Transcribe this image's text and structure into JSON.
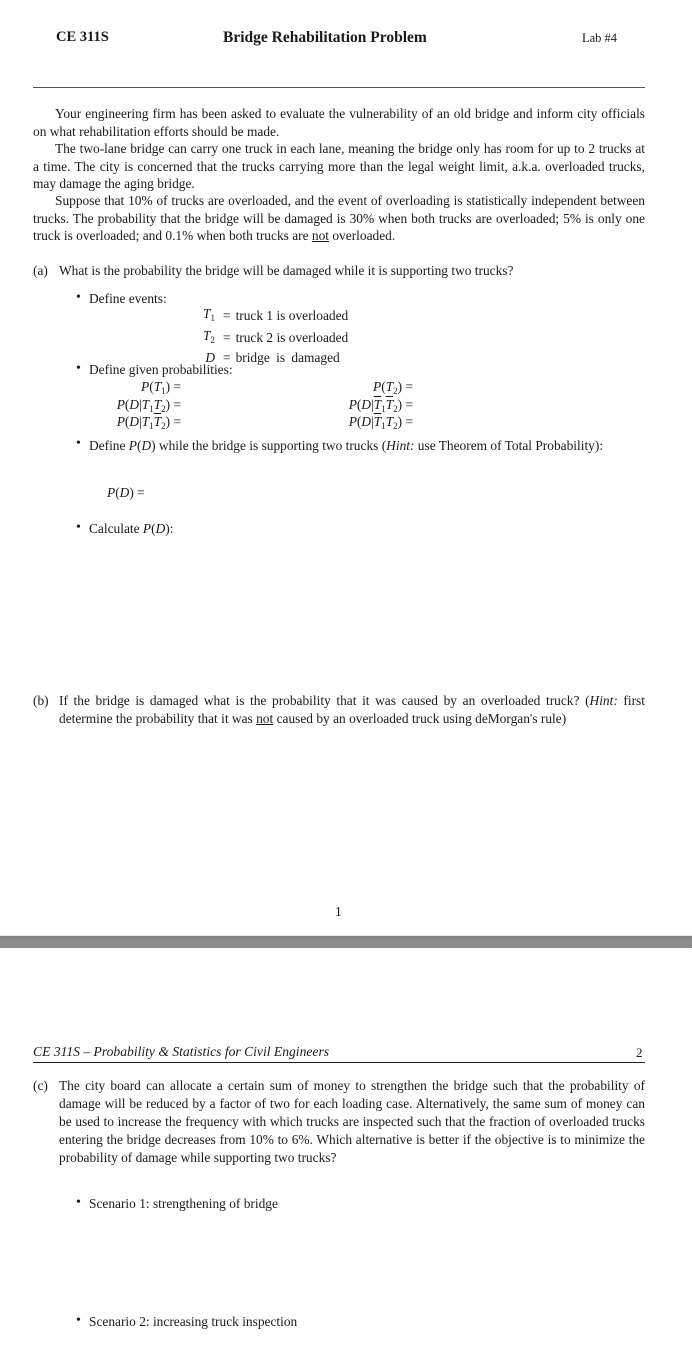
{
  "header": {
    "course": "CE 311S",
    "title": "Bridge Rehabilitation Problem",
    "lab": "Lab #4"
  },
  "intro": {
    "p1": "Your engineering firm has been asked to evaluate the vulnerability of an old bridge and inform city officials on what rehabilitation efforts should be made.",
    "p2": "The two-lane bridge can carry one truck in each lane, meaning the bridge only has room for up to 2 trucks at a time. The city is concerned that the trucks carrying more than the legal weight limit, a.k.a. overloaded trucks, may damage the aging bridge.",
    "p3_a": "Suppose that 10% of trucks are overloaded, and the event of overloading is statistically independent between trucks. The probability that the bridge will be damaged is 30% when both trucks are overloaded; 5% is only one truck is overloaded; and 0.1% when both trucks are ",
    "p3_u": "not",
    "p3_b": " overloaded."
  },
  "part_a": {
    "label": "(a)",
    "question": "What is the probability the bridge will be damaged while it is supporting two trucks?",
    "define_events_label": "Define events:",
    "events": [
      {
        "symbol": "T",
        "sub": "1",
        "eq": "=",
        "desc": "truck 1 is overloaded"
      },
      {
        "symbol": "T",
        "sub": "2",
        "eq": "=",
        "desc": "truck 2 is overloaded"
      },
      {
        "symbol": "D",
        "sub": "",
        "eq": "=",
        "desc": "bridge is damaged"
      }
    ],
    "define_probs_label": "Define given probabilities:",
    "probabilities_left": [
      "P(T1) =",
      "P(D|T1T2) =",
      "P(D|T1T̄2) ="
    ],
    "probabilities_right": [
      "P(T2) =",
      "P(D|T̄1T̄2) =",
      "P(D|T̄1T2) ="
    ],
    "define_pd_a": "Define ",
    "define_pd_b": " while the bridge is supporting two trucks (",
    "hint_label": "Hint:",
    "define_pd_c": " use Theorem of Total Probability):",
    "pd_expr": "P(D) =",
    "calc_label": "Calculate ",
    "calc_tail": ":",
    "pd": "P(D)"
  },
  "page1_number": "1",
  "part_b": {
    "label": "(b)",
    "q1": "If the bridge is damaged what is the probability that it was caused by an overloaded truck?",
    "hint_open": "(",
    "hint_label": "Hint:",
    "hint_a": " first determine the probability that it was ",
    "hint_u": "not",
    "hint_b": " caused by an overloaded truck using deMorgan's rule)"
  },
  "footer": {
    "course_title": "CE 311S – Probability & Statistics for Civil Engineers",
    "page": "2"
  },
  "part_c": {
    "label": "(c)",
    "question": "The city board can allocate a certain sum of money to strengthen the bridge such that the probability of damage will be reduced by a factor of two for each loading case. Alternatively, the same sum of money can be used to increase the frequency with which trucks are inspected such that the fraction of overloaded trucks entering the bridge decreases from 10% to 6%. Which alternative is better if the objective is to minimize the probability of damage while supporting two trucks?",
    "scenarios": [
      "Scenario 1: strengthening of bridge",
      "Scenario 2: increasing truck inspection"
    ]
  }
}
